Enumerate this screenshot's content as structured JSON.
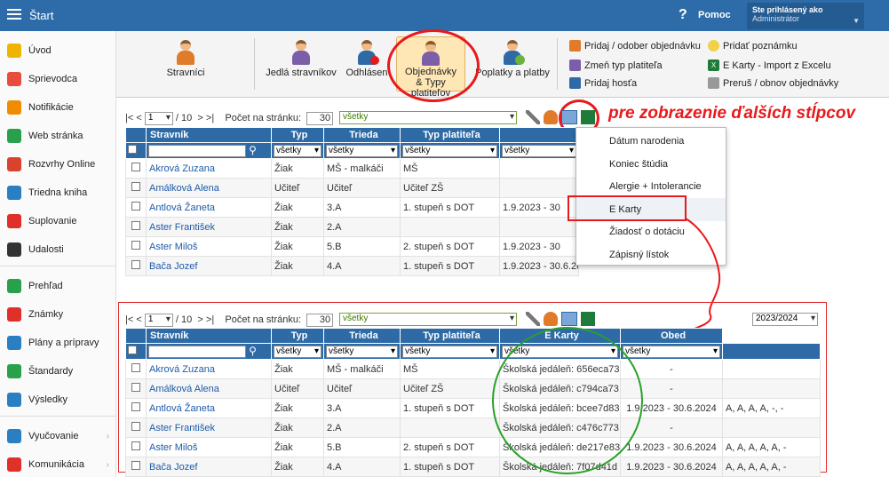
{
  "topbar": {
    "title": "Štart",
    "help_label": "Pomoc",
    "user_label": "Ste prihlásený ako",
    "user_role": "Administrátor"
  },
  "sidebar": {
    "items": [
      {
        "label": "Úvod",
        "icon": "star-icon",
        "color": "#f0b400"
      },
      {
        "label": "Sprievodca",
        "icon": "wand-icon",
        "color": "#e84c3d"
      },
      {
        "label": "Notifikácie",
        "icon": "envelope-icon",
        "color": "#f08c00"
      },
      {
        "label": "Web stránka",
        "icon": "home-icon",
        "color": "#2aa04a"
      },
      {
        "label": "Rozvrhy Online",
        "icon": "calendar-icon",
        "color": "#d9432d"
      },
      {
        "label": "Triedna kniha",
        "icon": "book-icon",
        "color": "#2a7fc2"
      },
      {
        "label": "Suplovanie",
        "icon": "lifebuoy-icon",
        "color": "#e0302a"
      },
      {
        "label": "Udalosti",
        "icon": "list-icon",
        "color": "#333333"
      },
      {
        "label": "Prehľad",
        "icon": "check-circle-icon",
        "color": "#2aa04a"
      },
      {
        "label": "Známky",
        "icon": "chart-icon",
        "color": "#e0302a"
      },
      {
        "label": "Plány a prípravy",
        "icon": "briefcase-icon",
        "color": "#2a7fc2"
      },
      {
        "label": "Štandardy",
        "icon": "shield-icon",
        "color": "#2aa04a"
      },
      {
        "label": "Výsledky",
        "icon": "bar-chart-icon",
        "color": "#2a7fc2"
      },
      {
        "label": "Vyučovanie",
        "icon": "folder-icon",
        "color": "#2a7fc2"
      },
      {
        "label": "Komunikácia",
        "icon": "chat-icon",
        "color": "#e0302a"
      }
    ]
  },
  "toolbar": {
    "buttons": [
      "Stravníci",
      "Jedlá stravníkov",
      "Odhlásen",
      "Objednávky & Typy platiteľov",
      "Poplatky a platby"
    ],
    "actions": [
      "Pridaj / odober objednávku",
      "Zmeň typ platiteľa",
      "Pridaj hosťa",
      "Pridať poznámku",
      "E Karty - Import z Excelu",
      "Preruš / obnov objednávky"
    ]
  },
  "pager": {
    "first": "|<",
    "prev": "<",
    "page": "1",
    "of_label": "/ 10",
    "next": ">",
    "last": ">|",
    "per_page_label": "Počet na stránku:",
    "per_page": "30",
    "filter": "všetky",
    "year": "2023/2024"
  },
  "annotation": "pre zobrazenie ďalších stĺpcov",
  "dropdown": [
    "Dátum narodenia",
    "Koniec štúdia",
    "Alergie + Intolerancie",
    "E Karty",
    "Žiadosť o dotáciu",
    "Zápisný lístok"
  ],
  "top_table": {
    "headers": [
      "Stravník",
      "Typ",
      "Trieda",
      "Typ platiteľa"
    ],
    "filters": [
      "všetky",
      "všetky",
      "všetky",
      "všetky"
    ],
    "rows": [
      [
        "Akrová Zuzana",
        "Žiak",
        "MŠ - malkáči",
        "MŠ",
        ""
      ],
      [
        "Amálková Alena",
        "Učiteľ",
        "Učiteľ",
        "Učiteľ ZŠ",
        ""
      ],
      [
        "Antlová Žaneta",
        "Žiak",
        "3.A",
        "1. stupeň  s DOT",
        "1.9.2023 - 30"
      ],
      [
        "Aster František",
        "Žiak",
        "2.A",
        "",
        ""
      ],
      [
        "Aster Miloš",
        "Žiak",
        "5.B",
        "2. stupeň  s DOT",
        "1.9.2023 - 30"
      ],
      [
        "Bača Jozef",
        "Žiak",
        "4.A",
        "1. stupeň  s DOT",
        "1.9.2023 - 30.6.2024"
      ]
    ]
  },
  "bottom_table": {
    "headers": [
      "Stravník",
      "Typ",
      "Trieda",
      "Typ platiteľa",
      "E Karty",
      "Obed"
    ],
    "filters": [
      "všetky",
      "všetky",
      "všetky",
      "všetky",
      "všetky"
    ],
    "rows": [
      [
        "Akrová Zuzana",
        "Žiak",
        "MŠ - malkáči",
        "MŠ",
        "Školská jedáleň: 656eca73",
        "-",
        ""
      ],
      [
        "Amálková Alena",
        "Učiteľ",
        "Učiteľ",
        "Učiteľ ZŠ",
        "Školská jedáleň: c794ca73",
        "-",
        ""
      ],
      [
        "Antlová Žaneta",
        "Žiak",
        "3.A",
        "1. stupeň  s DOT",
        "Školská jedáleň: bcee7d83",
        "1.9.2023 - 30.6.2024",
        "A, A, A, A, -, -"
      ],
      [
        "Aster František",
        "Žiak",
        "2.A",
        "",
        "Školská jedáleň: c476c773",
        "-",
        ""
      ],
      [
        "Aster Miloš",
        "Žiak",
        "5.B",
        "2. stupeň  s DOT",
        "Školská jedáleň: de217e83",
        "1.9.2023 - 30.6.2024",
        "A, A, A, A, A, -"
      ],
      [
        "Bača Jozef",
        "Žiak",
        "4.A",
        "1. stupeň  s DOT",
        "Školská jedáleň: 7f07d41d",
        "1.9.2023 - 30.6.2024",
        "A, A, A, A, A, -"
      ]
    ]
  }
}
